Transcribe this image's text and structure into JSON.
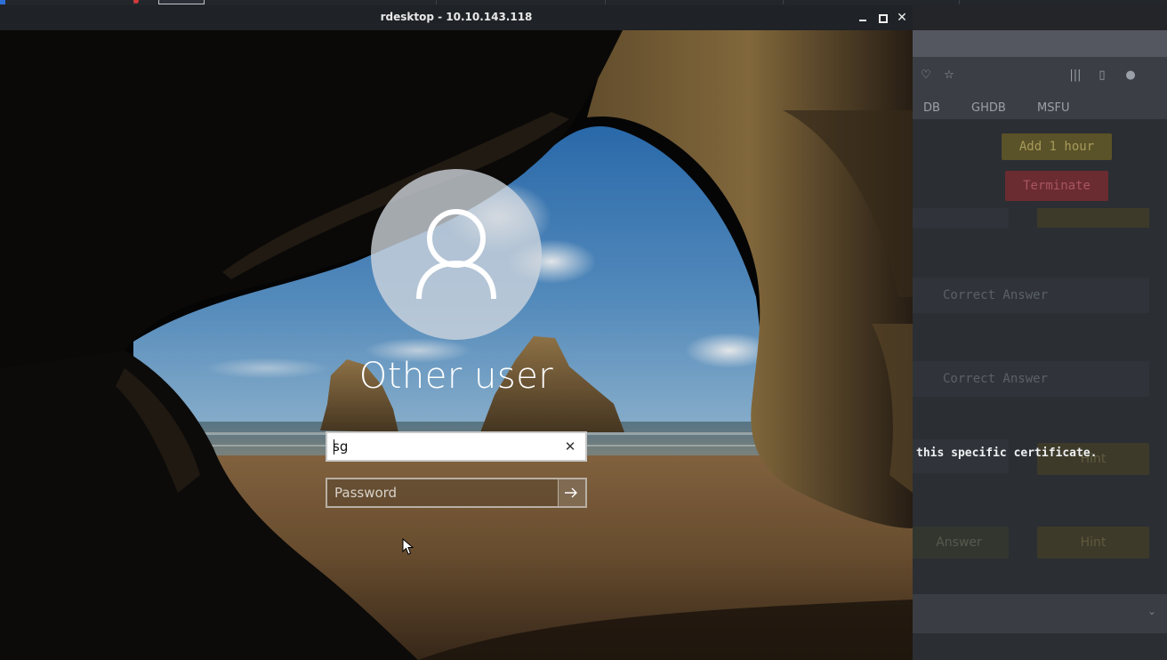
{
  "window": {
    "title": "rdesktop - 10.10.143.118",
    "controls": [
      "minimize-icon",
      "maximize-icon",
      "close-icon"
    ],
    "close_glyph": "✕"
  },
  "lock_screen": {
    "avatar_icon": "user-icon",
    "user_name": "Other user",
    "username_value": "sg",
    "clear_glyph": "✕",
    "password_placeholder": "Password",
    "submit_icon": "arrow-right-icon"
  },
  "background_browser": {
    "bookmarks": [
      "DB",
      "GHDB",
      "MSFU"
    ],
    "buttons": {
      "add_hour": "Add 1 hour",
      "terminate": "Terminate",
      "answer": "Answer",
      "hint": "Hint"
    },
    "answer_placeholder": "Correct Answer",
    "visible_text": "this specific certificate."
  },
  "colors": {
    "titlebar": "#1f2226",
    "avatar_circle": "#d0d6de",
    "add_hour_button": "#5a5228",
    "terminate_button": "#6a2b31"
  }
}
